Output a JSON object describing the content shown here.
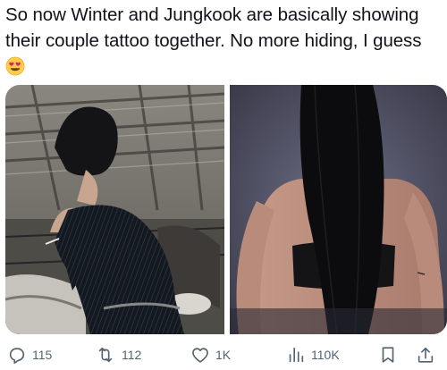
{
  "tweet": {
    "text": "So now Winter and Jungkook are basically showing their couple tattoo together. No more hiding, I guess",
    "emoji": "heart-eyes-emoji"
  },
  "media": {
    "left_photo": "photo-left",
    "right_photo": "photo-right"
  },
  "actions": {
    "replies": "115",
    "reposts": "112",
    "likes": "1K",
    "views": "110K"
  },
  "icons": {
    "reply": "reply-icon",
    "repost": "repost-icon",
    "like": "heart-icon",
    "views": "views-icon",
    "bookmark": "bookmark-icon",
    "share": "share-icon"
  },
  "colors": {
    "text": "#0f1419",
    "muted": "#536471"
  }
}
